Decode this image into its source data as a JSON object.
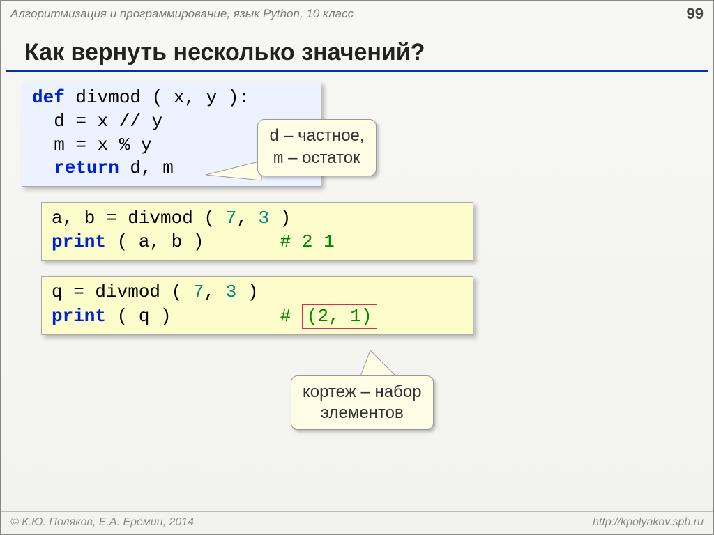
{
  "header": {
    "subject": "Алгоритмизация и программирование, язык Python, 10 класс",
    "page": "99"
  },
  "title": "Как вернуть несколько значений?",
  "code1": {
    "l1a": "def",
    "l1b": " divmod ( x, y ):",
    "l2": "  d = x // y",
    "l3": "  m = x % y",
    "l4a": "  return",
    "l4b": " d, m"
  },
  "callout1": {
    "line1a": "d",
    "line1b": " – частное,",
    "line2a": "m",
    "line2b": " – остаток"
  },
  "code2": {
    "l1a": "a, b = divmod ( ",
    "l1n1": "7",
    "l1m": ", ",
    "l1n2": "3",
    "l1b": " )",
    "l2a": "print",
    "l2b": " ( a, b )       ",
    "l2c": "# 2 1"
  },
  "code3": {
    "l1a": "q = divmod ( ",
    "l1n1": "7",
    "l1m": ", ",
    "l1n2": "3",
    "l1b": " )",
    "l2a": "print",
    "l2b": " ( q )          ",
    "l2c": "# ",
    "l2d": "(2, 1)"
  },
  "callout2": {
    "line1": "кортеж – набор",
    "line2": "элементов"
  },
  "footer": {
    "left": "© К.Ю. Поляков, Е.А. Ерёмин, 2014",
    "right": "http://kpolyakov.spb.ru"
  }
}
